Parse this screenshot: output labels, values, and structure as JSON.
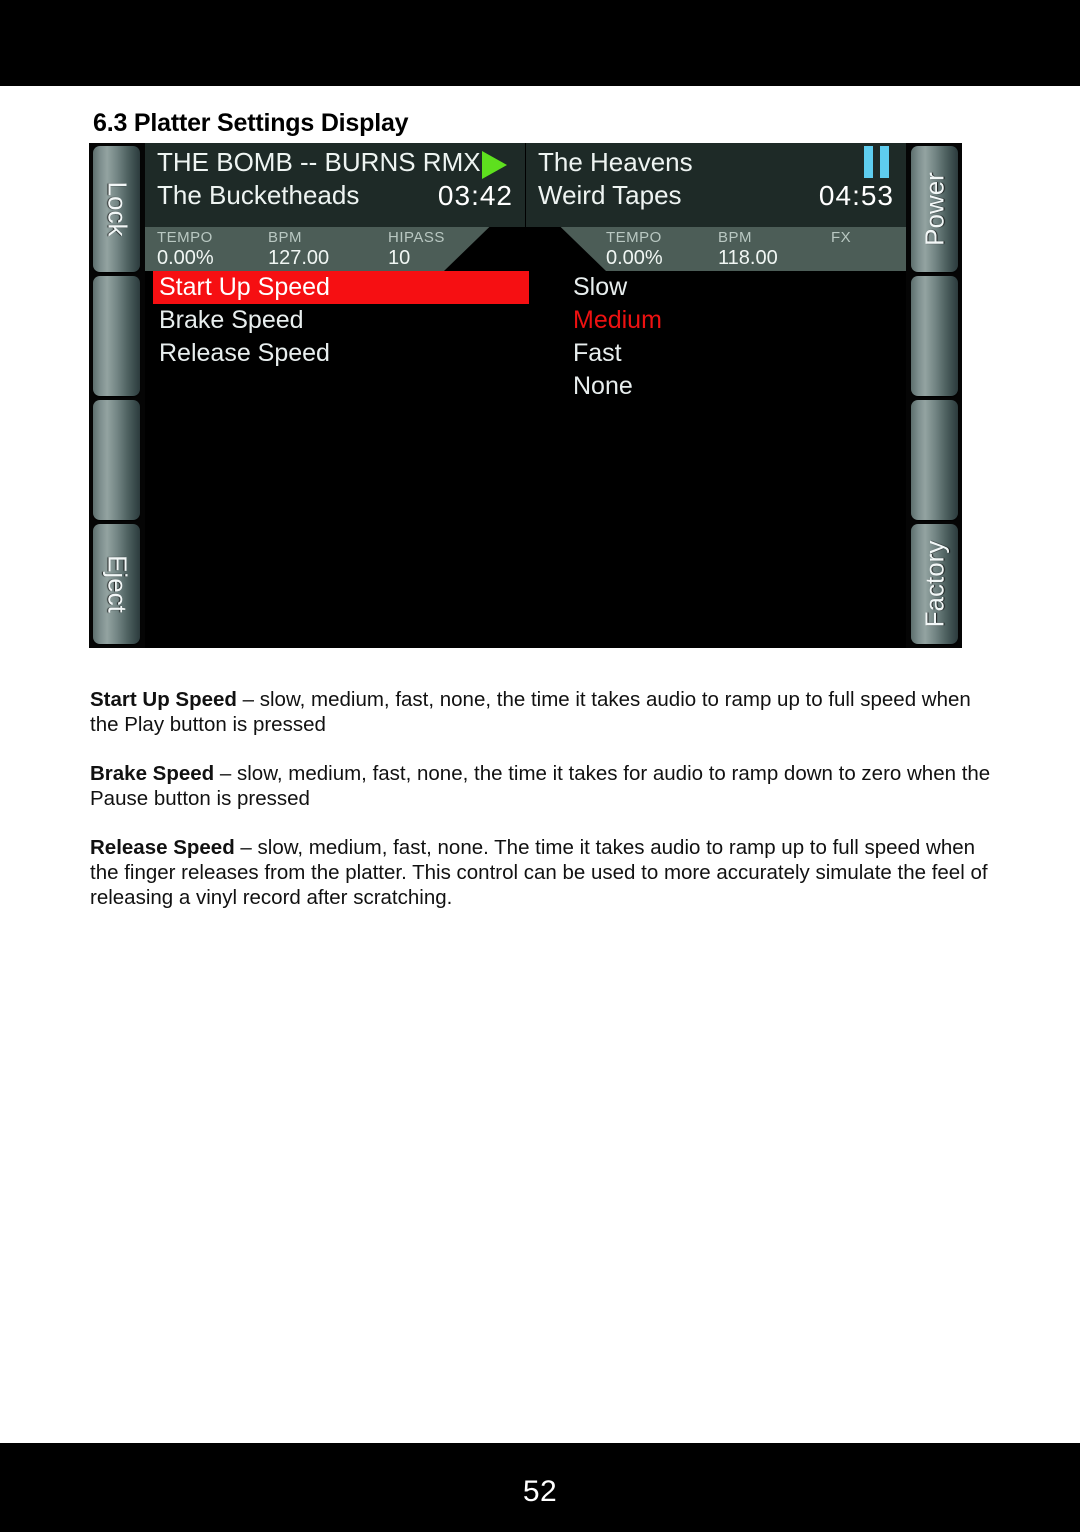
{
  "page": {
    "number": "52",
    "heading": "6.3 Platter Settings Display"
  },
  "device": {
    "left_rail": [
      {
        "label": "Lock"
      },
      {
        "label": ""
      },
      {
        "label": ""
      },
      {
        "label": "Eject"
      }
    ],
    "right_rail": [
      {
        "label": "Power"
      },
      {
        "label": ""
      },
      {
        "label": ""
      },
      {
        "label": "Factory"
      }
    ],
    "decks": [
      {
        "title": "THE BOMB -- BURNS RMX",
        "artist": "The Bucketheads",
        "time": "03:42",
        "transport_icon": "play-icon",
        "meta": [
          {
            "label": "TEMPO",
            "value": "0.00%"
          },
          {
            "label": "BPM",
            "value": "127.00"
          },
          {
            "label": "HIPASS",
            "value": "10"
          }
        ]
      },
      {
        "title": "The Heavens",
        "artist": "Weird Tapes",
        "time": "04:53",
        "transport_icon": "pause-icon",
        "meta": [
          {
            "label": "TEMPO",
            "value": "0.00%"
          },
          {
            "label": "BPM",
            "value": "118.00"
          },
          {
            "label": "FX",
            "value": ""
          }
        ]
      }
    ],
    "menu": {
      "items": [
        {
          "label": "Start Up Speed",
          "selected": true
        },
        {
          "label": "Brake Speed",
          "selected": false
        },
        {
          "label": "Release Speed",
          "selected": false
        }
      ],
      "options": [
        {
          "label": "Slow",
          "active": false
        },
        {
          "label": "Medium",
          "active": true
        },
        {
          "label": "Fast",
          "active": false
        },
        {
          "label": "None",
          "active": false
        }
      ]
    },
    "colors": {
      "selection_red": "#f60f12",
      "active_option_red": "#ee1111",
      "play_green": "#5ee01e",
      "pause_cyan": "#5ecdef",
      "title_bg": "#1e2a27",
      "meta_bg": "#4c5d57"
    }
  },
  "body": {
    "paragraphs": [
      {
        "term": "Start Up Speed",
        "text": " – slow, medium, fast, none, the time it takes audio to ramp up to full speed when the Play button is pressed"
      },
      {
        "term": "Brake Speed",
        "text": " – slow, medium, fast, none, the time it takes for audio to ramp down to zero when the Pause button is pressed"
      },
      {
        "term": "Release Speed",
        "text": " – slow, medium, fast, none. The time it takes audio to ramp up to full speed when the finger releases from the platter. This control can be used to more accurately simulate the feel of releasing a vinyl record after scratching."
      }
    ]
  }
}
